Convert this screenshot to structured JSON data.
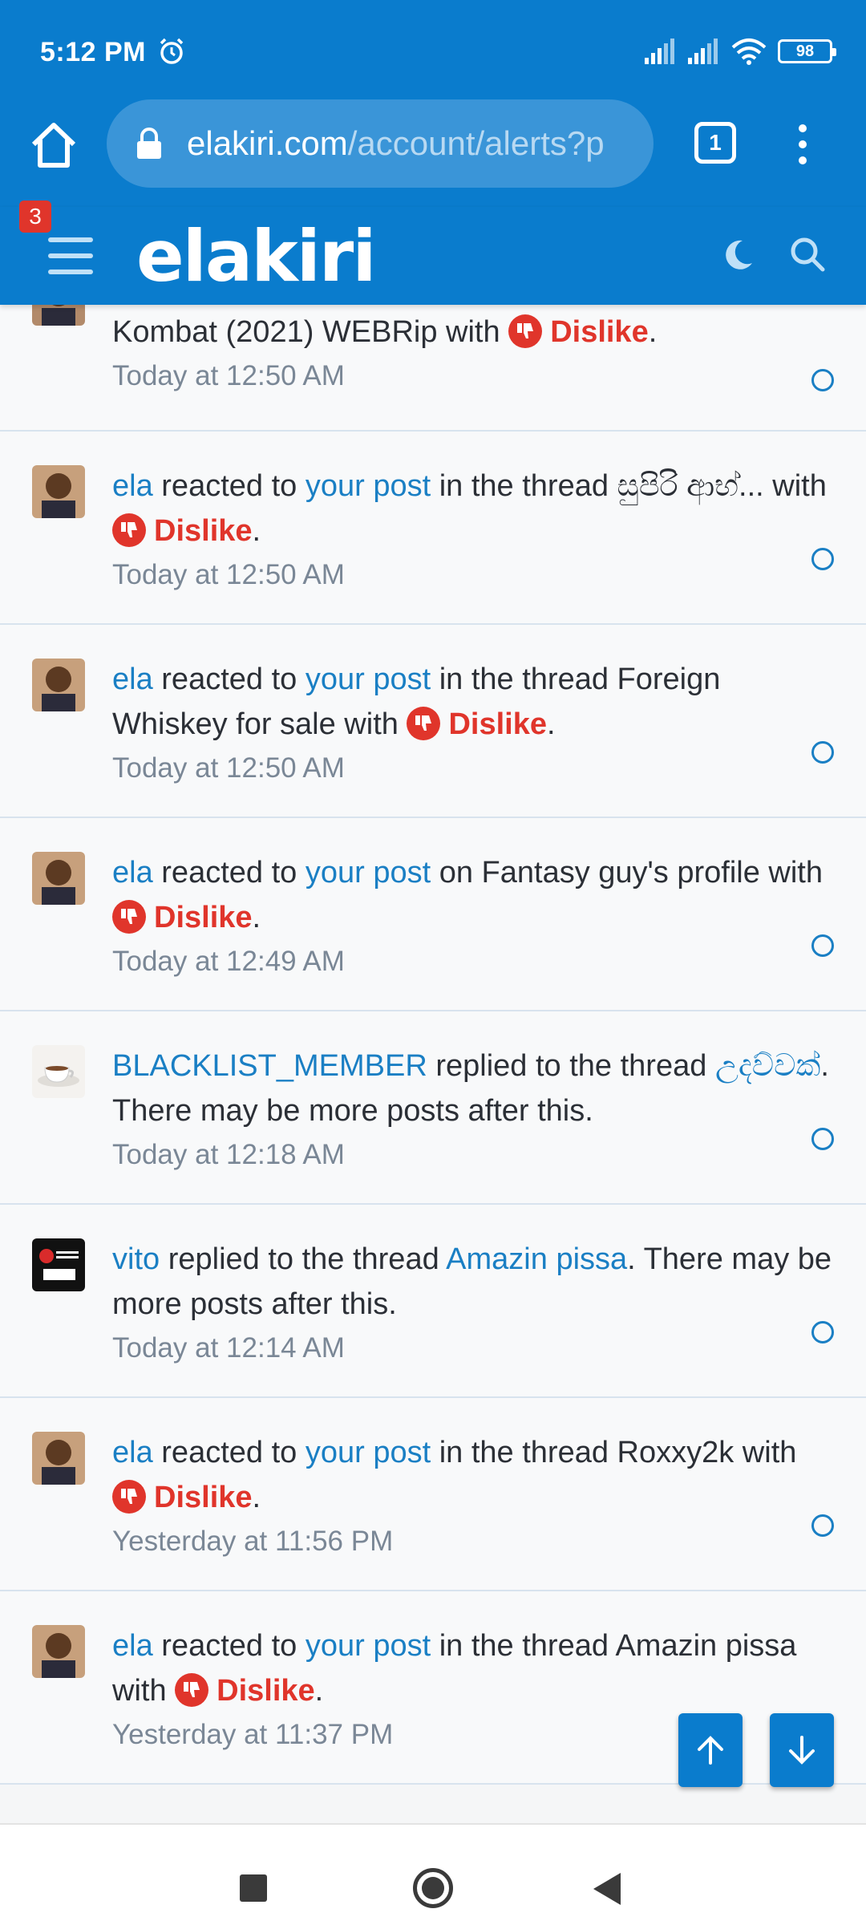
{
  "status_bar": {
    "time": "5:12 PM",
    "battery": "98"
  },
  "browser": {
    "url_domain": "elakiri.com",
    "url_path": "/account/alerts?p",
    "tab_count": "1"
  },
  "site": {
    "logo": "elakiri",
    "menu_badge": "3"
  },
  "alerts": [
    {
      "pre": "",
      "user": "",
      "mid": "Kombat (2021) WEBRip with ",
      "reaction": "Dislike",
      "tail": ".",
      "time": "Today at 12:50 AM"
    },
    {
      "user": "ela",
      "action": " reacted to ",
      "link": "your post",
      "text": " in the thread සුපිරි ආභ්... with ",
      "reaction": "Dislike",
      "tail": ".",
      "time": "Today at 12:50 AM"
    },
    {
      "user": "ela",
      "action": " reacted to ",
      "link": "your post",
      "text": " in the thread Foreign Whiskey for sale with ",
      "reaction": "Dislike",
      "tail": ".",
      "time": "Today at 12:50 AM"
    },
    {
      "user": "ela",
      "action": " reacted to ",
      "link": "your post",
      "text": " on Fantasy guy's profile with ",
      "reaction": "Dislike",
      "tail": ".",
      "time": "Today at 12:49 AM"
    },
    {
      "user": "BLACKLIST_MEMBER",
      "action": " replied to the thread ",
      "link": "උදව්වක්",
      "text": ". There may be more posts after this.",
      "time": "Today at 12:18 AM"
    },
    {
      "user": "vito",
      "action": " replied to the thread ",
      "link": "Amazin pissa",
      "text": ". There may be more posts after this.",
      "time": "Today at 12:14 AM"
    },
    {
      "user": "ela",
      "action": " reacted to ",
      "link": "your post",
      "text": " in the thread Roxxy2k with ",
      "reaction": "Dislike",
      "tail": ".",
      "time": "Yesterday at 11:56 PM"
    },
    {
      "user": "ela",
      "action": " reacted to ",
      "link": "your post",
      "text": " in the thread Amazin pissa with ",
      "reaction": "Dislike",
      "tail": ".",
      "time": "Yesterday at 11:37 PM"
    }
  ],
  "icons": {
    "home": "home-icon",
    "lock": "lock-icon",
    "menu": "more-vert-icon",
    "hamburger": "hamburger-icon",
    "moon": "moon-icon",
    "search": "search-icon",
    "thumb": "thumbs-down-icon",
    "scroll_up": "arrow-up-icon",
    "scroll_down": "arrow-down-icon"
  },
  "colors": {
    "brand": "#0a7ccd",
    "link": "#1a7fc4",
    "dislike": "#e0352b"
  }
}
